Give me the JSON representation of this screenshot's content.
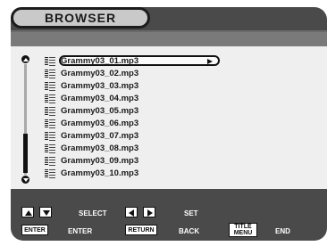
{
  "title": "BROWSER",
  "files": [
    "Grammy03_01.mp3",
    "Grammy03_02.mp3",
    "Grammy03_03.mp3",
    "Grammy03_04.mp3",
    "Grammy03_05.mp3",
    "Grammy03_06.mp3",
    "Grammy03_07.mp3",
    "Grammy03_08.mp3",
    "Grammy03_09.mp3",
    "Grammy03_10.mp3"
  ],
  "controls": {
    "select_label": "SELECT",
    "set_label": "SET",
    "enter_key": "ENTER",
    "enter_label": "ENTER",
    "return_key": "RETURN",
    "back_label": "BACK",
    "title_menu_key_line1": "TITLE",
    "title_menu_key_line2": "MENU",
    "end_label": "END"
  },
  "colors": {
    "panel": "#4a4a4a",
    "list_bg": "#efefef"
  }
}
